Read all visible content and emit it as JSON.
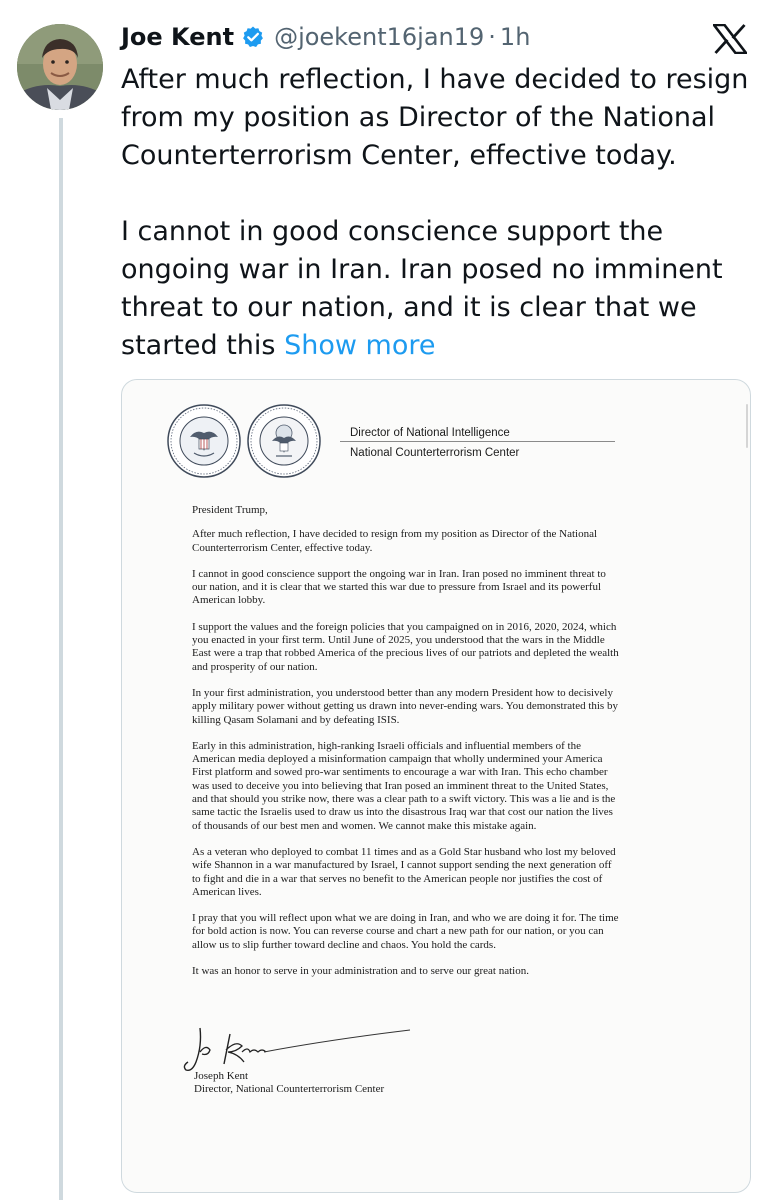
{
  "tweet": {
    "author": {
      "display_name": "Joe Kent",
      "handle": "@joekent16jan19",
      "separator": "·",
      "time": "1h",
      "verified_color": "#1d9bf0"
    },
    "text_paragraphs": [
      "After much reflection, I have decided to resign from my position as Director of the National Counterterrorism Center, effective today.",
      "I cannot in good conscience support the ongoing war in Iran. Iran posed no imminent threat to our nation, and it is clear that we started this"
    ],
    "show_more_label": "Show more",
    "colors": {
      "text": "#0f1419",
      "secondary": "#536471",
      "link": "#1d9bf0",
      "border": "#cfd9de"
    },
    "icons": {
      "avatar": "avatar-photo",
      "verified": "verified-badge-icon",
      "platform": "x-logo-icon"
    }
  },
  "letter": {
    "letterhead": {
      "line1": "Director of National Intelligence",
      "line2": "National Counterterrorism Center"
    },
    "salutation": "President Trump,",
    "paragraphs": [
      [
        "After much reflection, I have decided to resign from my position as Director of the National",
        "Counterterrorism Center, effective today."
      ],
      [
        "I cannot in good conscience support the ongoing war in Iran. Iran posed no imminent threat to",
        "our nation, and it is clear that we started this war due to pressure from Israel and its powerful",
        "American lobby."
      ],
      [
        "I support the values and the foreign policies that you campaigned on in 2016, 2020, 2024, which",
        "you enacted in your first term. Until June of 2025, you understood that the wars in the Middle",
        "East were a trap that robbed America of the precious lives of our patriots and depleted the wealth",
        "and prosperity of our nation."
      ],
      [
        "In your first administration, you understood better than any modern President how to decisively",
        "apply military power without getting us drawn into never-ending wars. You demonstrated this by",
        "killing Qasam Solamani and by defeating ISIS."
      ],
      [
        "Early in this administration, high-ranking Israeli officials and influential members of the",
        "American media deployed a misinformation campaign that wholly undermined your America",
        "First platform and sowed pro-war sentiments to encourage a war with Iran. This echo chamber",
        "was used to deceive you into believing that Iran posed an imminent threat to the United States,",
        "and that should you strike now, there was a clear path to a swift victory. This was a lie and is the",
        "same tactic the Israelis used to draw us into the disastrous Iraq war that cost our nation the lives",
        "of thousands of our best men and women. We cannot make this mistake again."
      ],
      [
        "As a veteran who deployed to combat 11 times and as a Gold Star husband who lost my beloved",
        "wife Shannon in a war manufactured by Israel, I cannot support sending the next generation off",
        "to fight and die in a war that serves no benefit to the American people nor justifies the cost of",
        "American lives."
      ],
      [
        "I pray that you will reflect upon what we are doing in Iran, and who we are doing it for. The time",
        "for bold action is now. You can reverse course and chart a new path for our nation, or you can",
        "allow us to slip further toward decline and chaos. You hold the cards."
      ],
      [
        "It was an honor to serve in your administration and to serve our great nation."
      ]
    ],
    "signature_text": "Joe Kent",
    "signature_name": "Joseph Kent",
    "signature_title": "Director, National Counterterrorism Center"
  }
}
